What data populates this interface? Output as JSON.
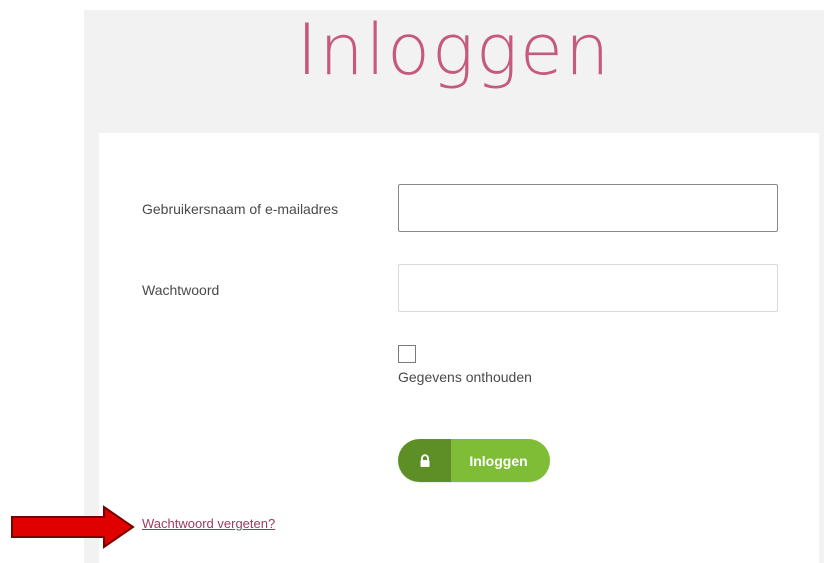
{
  "page": {
    "title": "Inloggen"
  },
  "form": {
    "username_label": "Gebruikersnaam of e-mailadres",
    "username_value": "",
    "password_label": "Wachtwoord",
    "password_value": "",
    "remember_label": "Gegevens onthouden",
    "remember_checked": false,
    "submit_label": "Inloggen",
    "forgot_link": "Wachtwoord vergeten?"
  },
  "icons": {
    "submit_icon": "lock-icon",
    "annotation": "red-arrow-icon"
  },
  "colors": {
    "title": "#c55a7c",
    "button_dark": "#5e8f27",
    "button_light": "#7ebd35",
    "link": "#9b3b5b",
    "arrow": "#e00000"
  }
}
